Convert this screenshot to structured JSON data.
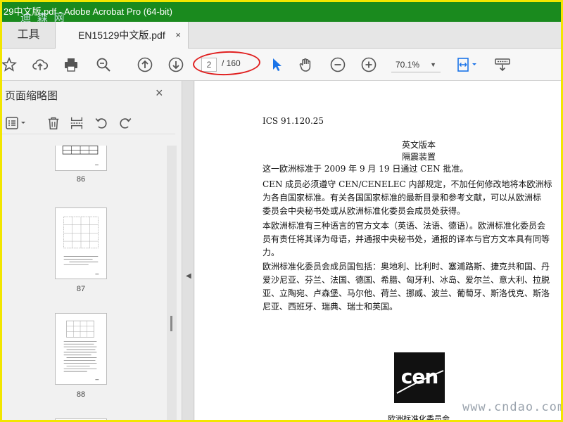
{
  "window": {
    "title": "29中文版.pdf - Adobe Acrobat Pro (64-bit)",
    "watermark_top": "迪 森 网"
  },
  "tabs": {
    "tools_label": "工具",
    "doc_label": "EN15129中文版.pdf",
    "close_glyph": "×"
  },
  "toolbar": {
    "icons": [
      "star-icon",
      "cloud-upload-icon",
      "print-icon",
      "zoom-search-icon",
      "page-up-icon",
      "page-down-icon",
      "select-cursor-icon",
      "hand-tool-icon",
      "zoom-out-icon",
      "zoom-in-icon",
      "fit-page-icon",
      "keyboard-icon"
    ],
    "current_page": "2",
    "total_pages": "/ 160",
    "zoom": "70.1%",
    "accent_color": "#1a73e8",
    "highlight_color": "#e02020"
  },
  "sidebar": {
    "title": "页面缩略图",
    "close_glyph": "×",
    "thumbnails": [
      {
        "label": "86"
      },
      {
        "label": "87"
      },
      {
        "label": "88"
      }
    ]
  },
  "document": {
    "ics": "ICS 91.120.25",
    "version": "英文版本",
    "subject": "隔震装置",
    "approval": "这一欧洲标准于 2009 年 9 月 19 日通过 CEN 批准。",
    "para1": [
      "CEN 成员必须遵守 CEN/CENELEC 内部规定，不加任何修改地将本欧洲标",
      "为各自国家标准。有关各国国家标准的最新目录和参考文献，可以从欧洲标",
      "委员会中央秘书处或从欧洲标准化委员会成员处获得。"
    ],
    "para2": [
      "本欧洲标准有三种语言的官方文本（英语、法语、德语）。欧洲标准化委员会",
      "员有责任将其译为母语，并通报中央秘书处，通报的译本与官方文本具有同等",
      "力。"
    ],
    "para3": [
      "欧洲标准化委员会成员国包括：奥地利、比利时、塞浦路斯、捷克共和国、丹",
      "爱沙尼亚、芬兰、法国、德国、希腊、匈牙利、冰岛、爱尔兰、意大利、拉脱",
      "亚、立陶宛、卢森堡、马尔他、荷兰、挪威、波兰、葡萄牙、斯洛伐克、斯洛",
      "尼亚、西班牙、瑞典、瑞士和英国。"
    ],
    "logo_text": "cen",
    "logo_caption": "欧洲标准化委员会"
  },
  "watermark_bottom": "www.cndao.com"
}
